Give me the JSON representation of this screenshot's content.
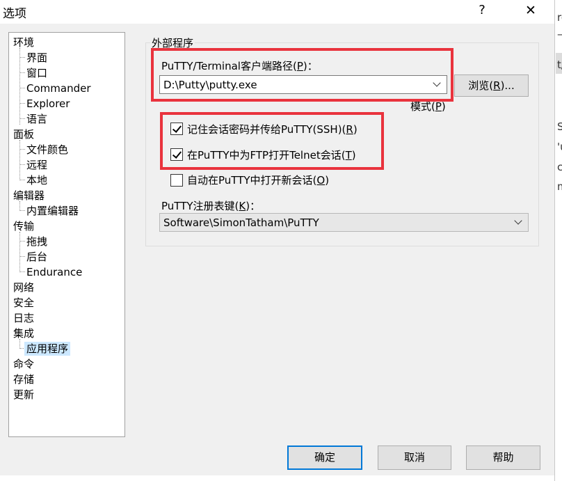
{
  "window": {
    "title": "选项",
    "help_glyph": "?",
    "close_glyph": "✕"
  },
  "tree": {
    "items": [
      "环境",
      "界面",
      "窗口",
      "Commander",
      "Explorer",
      "语言",
      "面板",
      "文件颜色",
      "远程",
      "本地",
      "编辑器",
      "内置编辑器",
      "传输",
      "拖拽",
      "后台",
      "Endurance",
      "网络",
      "安全",
      "日志",
      "集成",
      "应用程序",
      "命令",
      "存储",
      "更新"
    ],
    "selected": "应用程序"
  },
  "external_apps": {
    "group_title": "外部程序",
    "putty_path_label": "PuTTY/Terminal客户端路径(",
    "putty_path_key": "P",
    "putty_path_label_end": ")：",
    "putty_path_value": "D:\\Putty\\putty.exe",
    "browse_label": "浏览(",
    "browse_key": "R",
    "browse_label_end": ")...",
    "mode_label": "模式(",
    "mode_key": "P",
    "mode_label_end": ")",
    "checkboxes": [
      {
        "label": "记住会话密码并传给PuTTY(SSH)(",
        "key": "R",
        "end": ")",
        "checked": true
      },
      {
        "label": "在PuTTY中为FTP打开Telnet会话(",
        "key": "T",
        "end": ")",
        "checked": true
      },
      {
        "label": "自动在PuTTY中打开新会话(",
        "key": "O",
        "end": ")",
        "checked": false
      }
    ],
    "registry_label": "PuTTY注册表键(",
    "registry_key": "K",
    "registry_label_end": ")：",
    "registry_value": "Software\\SimonTatham\\PuTTY"
  },
  "buttons": {
    "ok": "确定",
    "cancel": "取消",
    "help": "帮助"
  },
  "background_window": {
    "fragments": [
      "ro",
      "—",
      "t/",
      "Se",
      "'u",
      "cr",
      "m"
    ]
  },
  "colors": {
    "highlight_box": "#e9333d",
    "selection": "#cce8ff",
    "default_button_border": "#0078d7"
  }
}
